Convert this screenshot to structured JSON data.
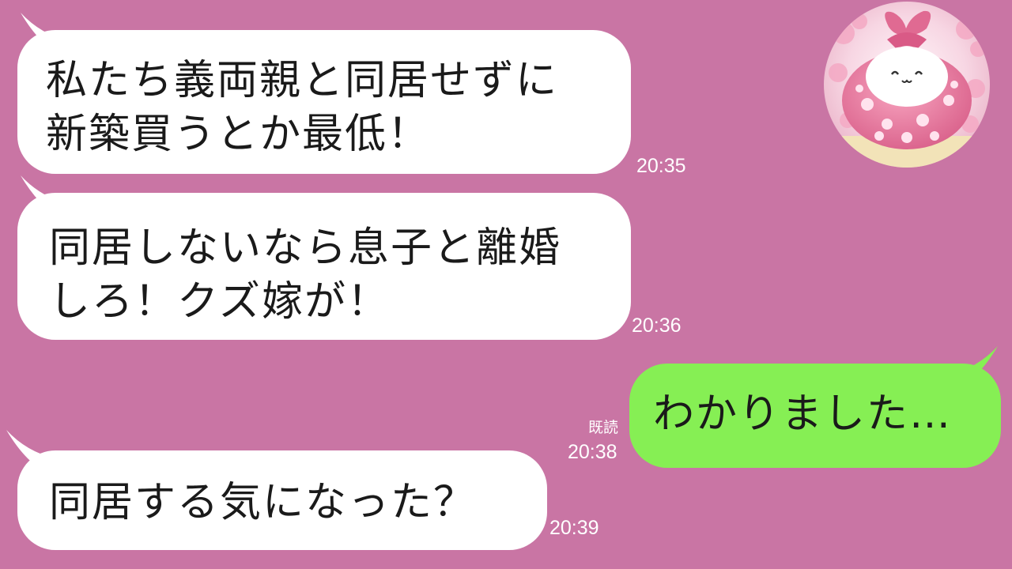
{
  "messages": [
    {
      "side": "received",
      "lines": [
        "私たち義両親と同居せずに",
        "新築買うとか最低！"
      ],
      "time": "20:35"
    },
    {
      "side": "received",
      "lines": [
        "同居しないなら息子と離婚",
        "しろ！クズ嫁が！"
      ],
      "time": "20:36"
    },
    {
      "side": "sent",
      "lines": [
        "わかりました…"
      ],
      "read_label": "既読",
      "time": "20:38"
    },
    {
      "side": "received",
      "lines": [
        "同居する気になった？"
      ],
      "time": "20:39"
    }
  ],
  "avatar": {
    "icon": "mochi-character-furoshiki-icon",
    "background": "cherry-blossoms"
  },
  "colors": {
    "background": "#c975a4",
    "received_bubble": "#ffffff",
    "sent_bubble": "#86ef54",
    "timestamp": "#ffffff"
  }
}
